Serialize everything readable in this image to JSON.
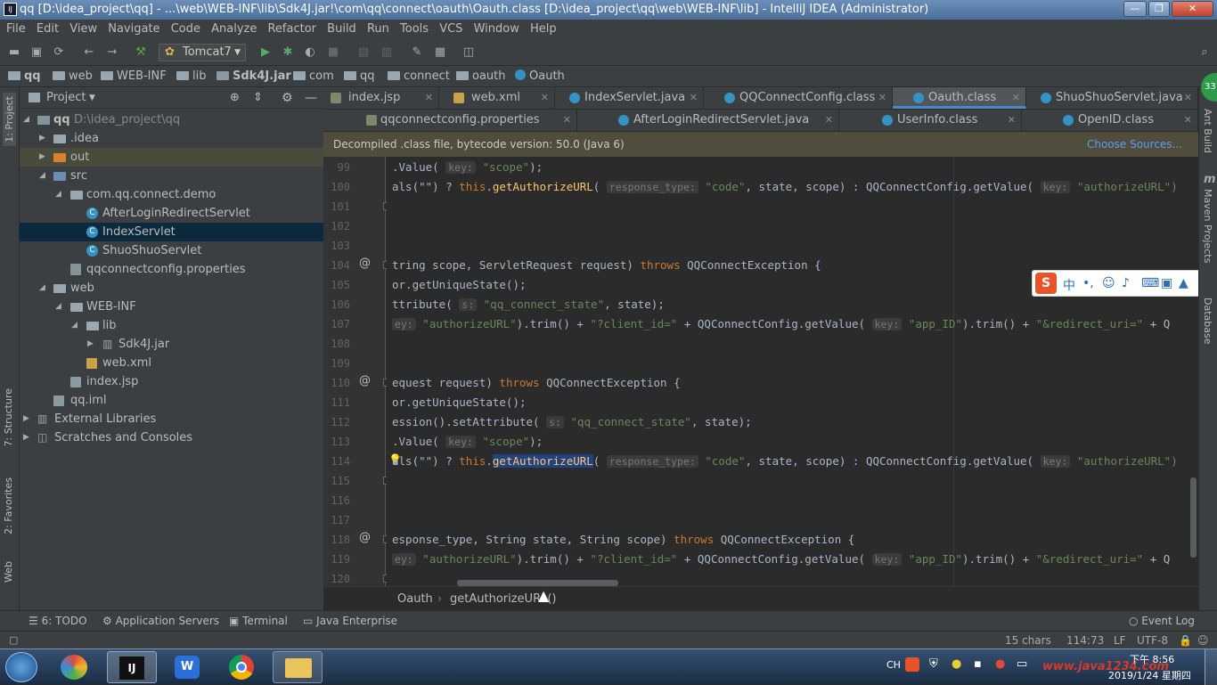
{
  "window": {
    "title": "qq [D:\\idea_project\\qq] - ...\\web\\WEB-INF\\lib\\Sdk4J.jar!\\com\\qq\\connect\\oauth\\Oauth.class [D:\\idea_project\\qq\\web\\WEB-INF\\lib] - IntelliJ IDEA (Administrator)",
    "app_icon": "IJ",
    "minimize": "—",
    "maximize": "❐",
    "close": "✕"
  },
  "menu": [
    "File",
    "Edit",
    "View",
    "Navigate",
    "Code",
    "Analyze",
    "Refactor",
    "Build",
    "Run",
    "Tools",
    "VCS",
    "Window",
    "Help"
  ],
  "toolbar": {
    "run_config": "Tomcat7"
  },
  "navbar": {
    "crumbs": [
      "qq",
      "web",
      "WEB-INF",
      "lib",
      "Sdk4J.jar",
      "com",
      "qq",
      "connect",
      "oauth",
      "Oauth"
    ]
  },
  "left_strip": {
    "project": "1: Project",
    "structure": "7: Structure",
    "favorites": "2: Favorites",
    "web": "Web"
  },
  "right_strip": {
    "ant": "Ant Build",
    "maven": "Maven Projects",
    "database": "Database",
    "badge": "33"
  },
  "project_panel": {
    "title": "Project",
    "tree": [
      {
        "label": "qq",
        "extra": "D:\\idea_project\\qq"
      },
      {
        "label": ".idea"
      },
      {
        "label": "out"
      },
      {
        "label": "src"
      },
      {
        "label": "com.qq.connect.demo"
      },
      {
        "label": "AfterLoginRedirectServlet"
      },
      {
        "label": "IndexServlet"
      },
      {
        "label": "ShuoShuoServlet"
      },
      {
        "label": "qqconnectconfig.properties"
      },
      {
        "label": "web"
      },
      {
        "label": "WEB-INF"
      },
      {
        "label": "lib"
      },
      {
        "label": "Sdk4J.jar"
      },
      {
        "label": "web.xml"
      },
      {
        "label": "index.jsp"
      },
      {
        "label": "qq.iml"
      },
      {
        "label": "External Libraries"
      },
      {
        "label": "Scratches and Consoles"
      }
    ]
  },
  "tabs_row1": [
    "index.jsp",
    "web.xml",
    "IndexServlet.java",
    "QQConnectConfig.class",
    "Oauth.class",
    "ShuoShuoServlet.java"
  ],
  "tabs_row2": [
    "qqconnectconfig.properties",
    "AfterLoginRedirectServlet.java",
    "UserInfo.class",
    "OpenID.class"
  ],
  "banner": {
    "text": "Decompiled .class file, bytecode version: 50.0 (Java 6)",
    "link": "Choose Sources..."
  },
  "code": {
    "line_numbers": [
      "99",
      "100",
      "101",
      "102",
      "103",
      "104",
      "105",
      "106",
      "107",
      "108",
      "109",
      "110",
      "111",
      "112",
      "113",
      "114",
      "115",
      "116",
      "117",
      "118",
      "119",
      "120"
    ],
    "l99": [
      ".Value( ",
      "key:",
      " \"scope\"",
      ");"
    ],
    "l100": [
      "als(\"\") ? ",
      "this",
      ".",
      "getAuthorizeURL",
      "( ",
      "response_type:",
      " \"code\"",
      ", state, scope) : QQConnectConfig.getValue( ",
      "key:",
      " \"authorizeURL\")"
    ],
    "l104": [
      "tring scope, ServletRequest request) ",
      "throws",
      " QQConnectException {"
    ],
    "l105": [
      "or.getUniqueState();"
    ],
    "l106": [
      "ttribute( ",
      "s:",
      " \"qq_connect_state\"",
      ", state);"
    ],
    "l107": [
      "ey:",
      " \"authorizeURL\"",
      ").trim() + ",
      "\"?client_id=\"",
      " + QQConnectConfig.getValue( ",
      "key:",
      " \"app_ID\"",
      ").trim() + ",
      "\"&redirect_uri=\"",
      " + Q"
    ],
    "l110": [
      "equest request) ",
      "throws",
      " QQConnectException {"
    ],
    "l111": [
      "or.getUniqueState();"
    ],
    "l112": [
      "ession().setAttribute( ",
      "s:",
      " \"qq_connect_state\"",
      ", state);"
    ],
    "l113": [
      ".Value( ",
      "key:",
      " \"scope\"",
      ");"
    ],
    "l114": [
      "als(\"\") ? ",
      "this",
      ".",
      "getAuthorizeURL",
      "( ",
      "response_type:",
      " \"code\"",
      ", state, scope) : QQConnectConfig.getValue( ",
      "key:",
      " \"authorizeURL\")"
    ],
    "l118": [
      "esponse_type, String state, String scope) ",
      "throws",
      " QQConnectException {"
    ],
    "l119": [
      "ey:",
      " \"authorizeURL\"",
      ").trim() + ",
      "\"?client_id=\"",
      " + QQConnectConfig.getValue( ",
      "key:",
      " \"app_ID\"",
      ").trim() + ",
      "\"&redirect_uri=\"",
      " + Q"
    ]
  },
  "editor_breadcrumb": [
    "Oauth",
    "getAuthorizeURL()"
  ],
  "bottom_tools": {
    "todo": "6: TODO",
    "app_servers": "Application Servers",
    "terminal": "Terminal",
    "java_ent": "Java Enterprise",
    "event_log": "Event Log"
  },
  "status": {
    "chars": "15 chars",
    "position": "114:73",
    "line_sep": "LF",
    "encoding": "UTF-8"
  },
  "ime": {
    "chars": "中"
  },
  "tray": {
    "lang": "CH",
    "time": "下午 8:56",
    "date": "2019/1/24 星期四",
    "watermark": "www.java1234.com"
  }
}
